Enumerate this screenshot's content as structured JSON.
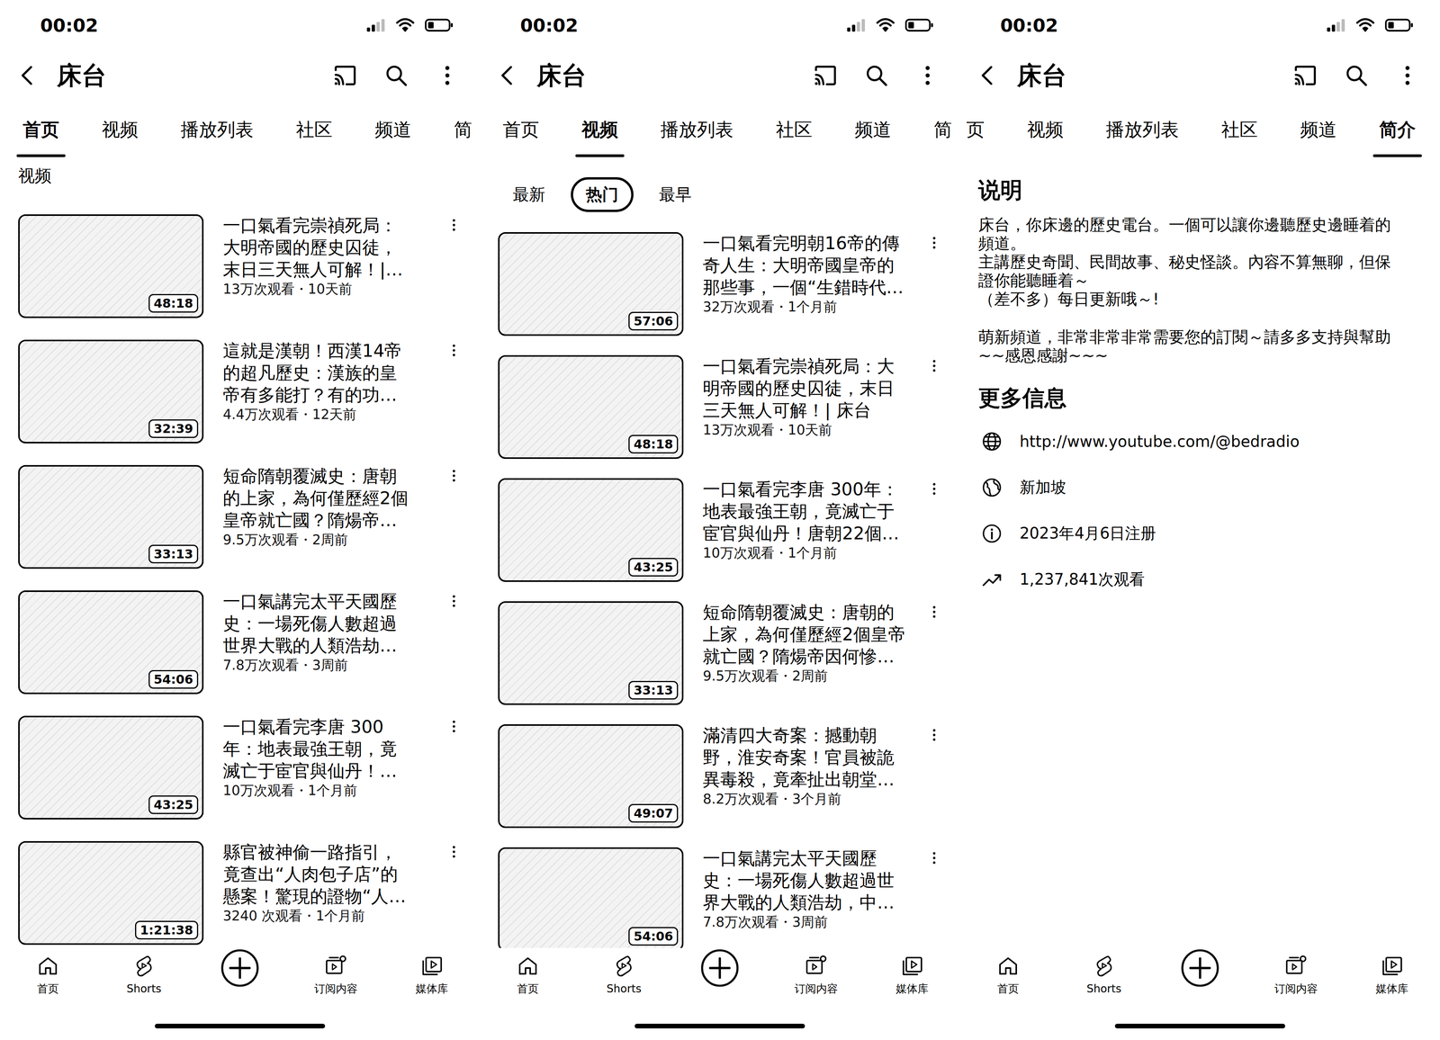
{
  "screens": [
    {
      "status_bar": {
        "time": "00:02"
      },
      "header": {
        "title": "床台"
      },
      "tab_bar": {
        "scrolled": false,
        "tabs": [
          {
            "label": "首页",
            "selected": true
          },
          {
            "label": "视频",
            "selected": false
          },
          {
            "label": "播放列表",
            "selected": false
          },
          {
            "label": "社区",
            "selected": false
          },
          {
            "label": "频道",
            "selected": false
          },
          {
            "label": "简",
            "selected": false
          }
        ]
      },
      "content": {
        "kind": "home",
        "section_label": "视频",
        "videos": [
          {
            "title_lines": [
              "一口氣看完崇禎死局：",
              "大明帝國的歷史囚徒，",
              "末日三天無人可解！|…"
            ],
            "meta": "13万次观看・10天前",
            "duration": "48:18"
          },
          {
            "title_lines": [
              "這就是漢朝！西漢14帝",
              "的超凡歷史：漢族的皇",
              "帝有多能打？有的功…"
            ],
            "meta": "4.4万次观看・12天前",
            "duration": "32:39"
          },
          {
            "title_lines": [
              "短命隋朝覆滅史：唐朝",
              "的上家，為何僅歷經2個",
              "皇帝就亡國？隋煬帝…"
            ],
            "meta": "9.5万次观看・2周前",
            "duration": "33:13"
          },
          {
            "title_lines": [
              "一口氣講完太平天國歷",
              "史：一場死傷人數超過",
              "世界大戰的人類浩劫…"
            ],
            "meta": "7.8万次观看・3周前",
            "duration": "54:06"
          },
          {
            "title_lines": [
              "一口氣看完李唐 300",
              "年：地表最強王朝，竟",
              "滅亡于宦官與仙丹！…"
            ],
            "meta": "10万次观看・1个月前",
            "duration": "43:25"
          },
          {
            "title_lines": [
              "縣官被神偷一路指引，",
              "竟查出“人肉包子店”的",
              "懸案！驚現的證物“人…"
            ],
            "meta": "3240 次观看・1个月前",
            "duration": "1:21:38"
          }
        ]
      },
      "bottom_nav": [
        {
          "kind": "tab",
          "label": "首页"
        },
        {
          "kind": "tab",
          "label": "Shorts"
        },
        {
          "kind": "button",
          "label": ""
        },
        {
          "kind": "tab",
          "label": "订阅内容"
        },
        {
          "kind": "tab",
          "label": "媒体库"
        }
      ]
    },
    {
      "status_bar": {
        "time": "00:02"
      },
      "header": {
        "title": "床台"
      },
      "tab_bar": {
        "scrolled": false,
        "tabs": [
          {
            "label": "首页",
            "selected": false
          },
          {
            "label": "视频",
            "selected": true
          },
          {
            "label": "播放列表",
            "selected": false
          },
          {
            "label": "社区",
            "selected": false
          },
          {
            "label": "频道",
            "selected": false
          },
          {
            "label": "简",
            "selected": false
          }
        ]
      },
      "content": {
        "kind": "videos",
        "chips": [
          {
            "label": "最新",
            "selected": false
          },
          {
            "label": "热门",
            "selected": true
          },
          {
            "label": "最早",
            "selected": false
          }
        ],
        "videos": [
          {
            "title_lines": [
              "一口氣看完明朝16帝的傳",
              "奇人生：大明帝國皇帝的",
              "那些事，一個“生錯時代…"
            ],
            "meta": "32万次观看・1个月前",
            "duration": "57:06"
          },
          {
            "title_lines": [
              "一口氣看完崇禎死局：大",
              "明帝國的歷史囚徒，末日",
              "三天無人可解！| 床台"
            ],
            "meta": "13万次观看・10天前",
            "duration": "48:18"
          },
          {
            "title_lines": [
              "一口氣看完李唐 300年：",
              "地表最強王朝，竟滅亡于",
              "宦官與仙丹！唐朝22個…"
            ],
            "meta": "10万次观看・1个月前",
            "duration": "43:25"
          },
          {
            "title_lines": [
              "短命隋朝覆滅史：唐朝的",
              "上家，為何僅歷經2個皇帝",
              "就亡國？隋煬帝因何慘…"
            ],
            "meta": "9.5万次观看・2周前",
            "duration": "33:13"
          },
          {
            "title_lines": [
              "滿清四大奇案：撼動朝",
              "野，淮安奇案！官員被詭",
              "異毒殺，竟牽扯出朝堂…"
            ],
            "meta": "8.2万次观看・3个月前",
            "duration": "49:07"
          },
          {
            "title_lines": [
              "一口氣講完太平天國歷",
              "史：一場死傷人數超過世",
              "界大戰的人類浩劫，中…"
            ],
            "meta": "7.8万次观看・3周前",
            "duration": "54:06"
          }
        ]
      },
      "bottom_nav": [
        {
          "kind": "tab",
          "label": "首页"
        },
        {
          "kind": "tab",
          "label": "Shorts"
        },
        {
          "kind": "button",
          "label": ""
        },
        {
          "kind": "tab",
          "label": "订阅内容"
        },
        {
          "kind": "tab",
          "label": "媒体库"
        }
      ]
    },
    {
      "status_bar": {
        "time": "00:02"
      },
      "header": {
        "title": "床台"
      },
      "tab_bar": {
        "scrolled": true,
        "tabs": [
          {
            "label": "页",
            "selected": false
          },
          {
            "label": "视频",
            "selected": false
          },
          {
            "label": "播放列表",
            "selected": false
          },
          {
            "label": "社区",
            "selected": false
          },
          {
            "label": "频道",
            "selected": false
          },
          {
            "label": "简介",
            "selected": true
          }
        ]
      },
      "content": {
        "kind": "about",
        "description_title": "说明",
        "description_paragraphs": [
          [
            "床台，你床邊的歷史電台。一個可以讓你邊聽歷史邊睡着的",
            "頻道。",
            "主講歷史奇聞、民間故事、秘史怪談。內容不算無聊，但保",
            "證你能聽睡着～",
            "（差不多）每日更新哦～!"
          ],
          [
            "萌新頻道，非常非常非常需要您的訂閱～請多多支持與幫助",
            "~~感恩感謝~~~"
          ]
        ],
        "more_info_title": "更多信息",
        "info_rows": [
          {
            "text": "http://www.youtube.com/@bedradio"
          },
          {
            "text": "新加坡"
          },
          {
            "text": "2023年4月6日注册"
          },
          {
            "text": "1,237,841次观看"
          }
        ]
      },
      "bottom_nav": [
        {
          "kind": "tab",
          "label": "首页"
        },
        {
          "kind": "tab",
          "label": "Shorts"
        },
        {
          "kind": "button",
          "label": ""
        },
        {
          "kind": "tab",
          "label": "订阅内容"
        },
        {
          "kind": "tab",
          "label": "媒体库"
        }
      ]
    }
  ]
}
